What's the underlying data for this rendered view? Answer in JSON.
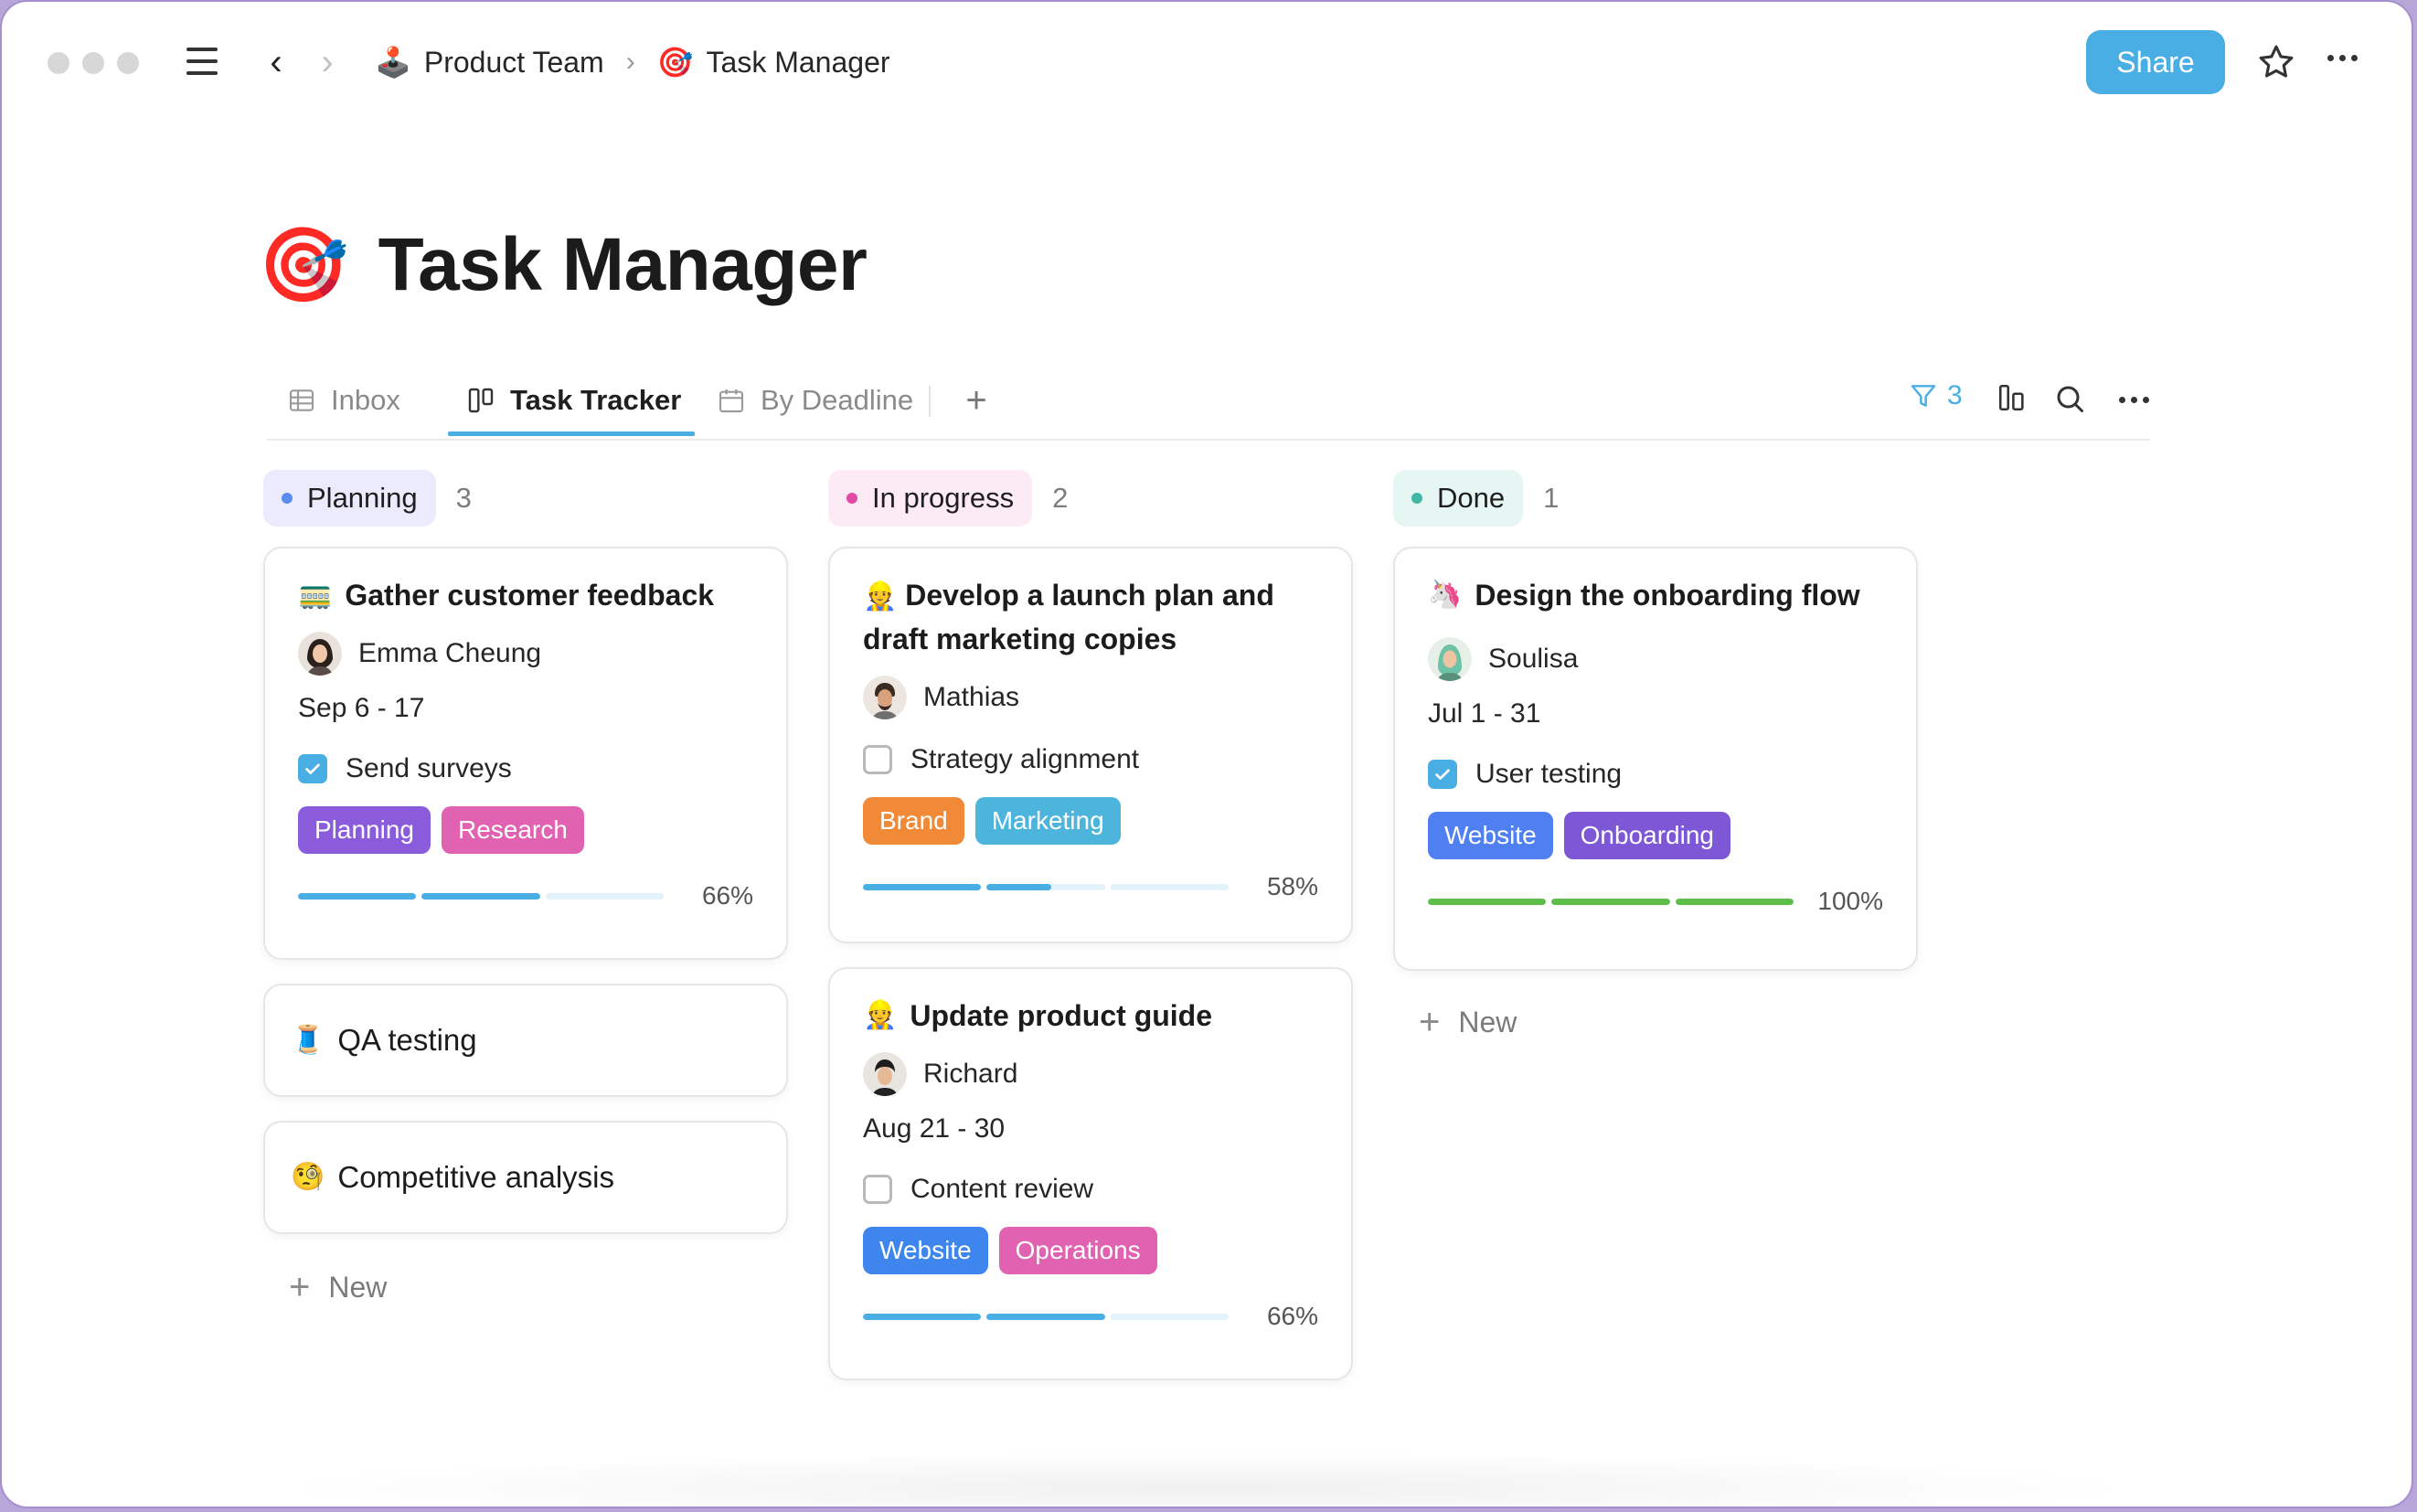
{
  "breadcrumb": {
    "items": [
      {
        "emoji": "🕹️",
        "label": "Product Team"
      },
      {
        "emoji": "🎯",
        "label": "Task Manager"
      }
    ],
    "separator": "›"
  },
  "header": {
    "share_label": "Share",
    "icons": {
      "menu": "hamburger-icon",
      "back": "chevron-left-icon",
      "forward": "chevron-right-icon",
      "star": "star-icon",
      "more": "more-icon"
    }
  },
  "page": {
    "emoji": "🎯",
    "title": "Task Manager"
  },
  "tabs": {
    "items": [
      {
        "label": "Inbox",
        "icon": "table-icon"
      },
      {
        "label": "Task Tracker",
        "icon": "board-icon",
        "active": true
      },
      {
        "label": "By Deadline",
        "icon": "calendar-icon"
      }
    ],
    "filter_count": "3"
  },
  "colors": {
    "accent": "#49aee3",
    "progress_bar": "#49aee3",
    "progress_done": "#5dbf4a"
  },
  "columns": [
    {
      "status": "Planning",
      "count": "3",
      "dot": "#5b8def",
      "pill_bg": "#eceafd",
      "cards": [
        {
          "emoji": "🚃",
          "title": "Gather customer feedback",
          "assignee": "Emma Cheung",
          "date": "Sep 6 - 17",
          "checklist": {
            "label": "Send surveys",
            "checked": true
          },
          "tags": [
            {
              "label": "Planning",
              "color": "#8a5cdb"
            },
            {
              "label": "Research",
              "color": "#e062b1"
            }
          ],
          "progress": 66
        },
        {
          "emoji": "🧵",
          "title": "QA testing"
        },
        {
          "emoji": "🧐",
          "title": "Competitive analysis"
        }
      ],
      "new_label": "New"
    },
    {
      "status": "In progress",
      "count": "2",
      "dot": "#e24aa8",
      "pill_bg": "#fcebf4",
      "cards": [
        {
          "emoji": "👷",
          "title": "Develop a launch plan and draft marketing copies",
          "assignee": "Mathias",
          "checklist": {
            "label": "Strategy alignment",
            "checked": false
          },
          "tags": [
            {
              "label": "Brand",
              "color": "#f08a36"
            },
            {
              "label": "Marketing",
              "color": "#4db5dc"
            }
          ],
          "progress": 58
        },
        {
          "emoji": "👷",
          "title": "Update product guide",
          "assignee": "Richard",
          "date": "Aug 21 - 30",
          "checklist": {
            "label": "Content review",
            "checked": false
          },
          "tags": [
            {
              "label": "Website",
              "color": "#3e86ee"
            },
            {
              "label": "Operations",
              "color": "#e062b1"
            }
          ],
          "progress": 66
        }
      ]
    },
    {
      "status": "Done",
      "count": "1",
      "dot": "#3fb8a6",
      "pill_bg": "#e6f6f3",
      "cards": [
        {
          "emoji": "🦄",
          "title": "Design the onboarding flow",
          "assignee": "Soulisa",
          "date": "Jul 1 - 31",
          "checklist": {
            "label": "User testing",
            "checked": true
          },
          "tags": [
            {
              "label": "Website",
              "color": "#4f7ff0"
            },
            {
              "label": "Onboarding",
              "color": "#7d57d6"
            }
          ],
          "progress": 100
        }
      ],
      "new_label": "New"
    }
  ]
}
